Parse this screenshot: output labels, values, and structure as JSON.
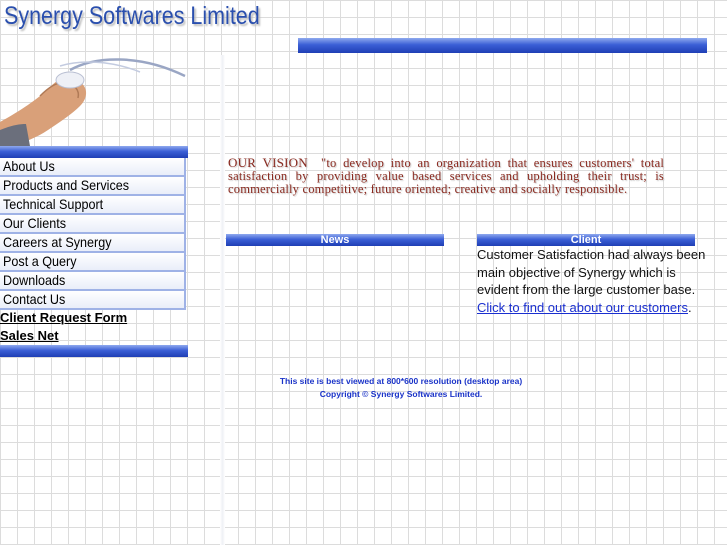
{
  "header": {
    "site_title": "Synergy Softwares Limited"
  },
  "sidebar": {
    "nav_items": [
      {
        "label": "About Us"
      },
      {
        "label": "Products and Services"
      },
      {
        "label": "Technical Support"
      },
      {
        "label": "Our Clients"
      },
      {
        "label": "Careers at Synergy"
      },
      {
        "label": "Post a Query"
      },
      {
        "label": "Downloads"
      },
      {
        "label": "Contact Us"
      }
    ],
    "links": {
      "client_request": "Client Request Form",
      "sales_net": "Sales Net"
    }
  },
  "vision": {
    "label": "OUR VISION",
    "text": "\"to develop into an organization that ensures customers' total satisfaction by providing value based services and upholding their trust; is commercially competitive; future oriented; creative and socially responsible."
  },
  "sections": {
    "news_title": "News",
    "client_title": "Client",
    "client_text": "Customer Satisfaction had always been main objective of Synergy which is evident from the large customer base.",
    "client_link": "Click to find out about our customers",
    "client_link_suffix": "."
  },
  "footer": {
    "line1": "This site is best viewed at 800*600 resolution (desktop area)",
    "line2": "Copyright © Synergy Softwares Limited."
  },
  "colors": {
    "title_blue": "#2a4fae",
    "bar_blue": "#2f52cc",
    "vision_red": "#8a2a20",
    "footer_blue": "#1a33c8",
    "link_blue": "#1a2fd0"
  },
  "icons": {
    "hand_image": "hand-on-mouse-image"
  }
}
